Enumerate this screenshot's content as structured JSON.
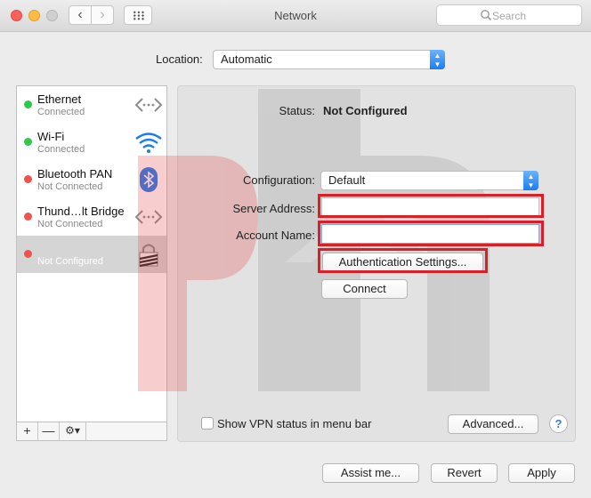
{
  "window": {
    "title": "Network"
  },
  "toolbar": {
    "search_placeholder": "Search"
  },
  "location": {
    "label": "Location:",
    "value": "Automatic"
  },
  "services": [
    {
      "name": "Ethernet",
      "status": "Connected",
      "dot": "green",
      "icon": "ethernet-icon"
    },
    {
      "name": "Wi-Fi",
      "status": "Connected",
      "dot": "green",
      "icon": "wifi-icon"
    },
    {
      "name": "Bluetooth PAN",
      "status": "Not Connected",
      "dot": "red",
      "icon": "bluetooth-icon"
    },
    {
      "name": "Thund…lt Bridge",
      "status": "Not Connected",
      "dot": "red",
      "icon": "thunderbolt-bridge-icon"
    },
    {
      "name": "",
      "status": "Not Configured",
      "dot": "red",
      "icon": "vpn-lock-icon"
    }
  ],
  "sidebar_footer": {
    "add": "+",
    "remove": "—",
    "gear": "⚙▾"
  },
  "detail": {
    "status_label": "Status:",
    "status_value": "Not Configured",
    "configuration_label": "Configuration:",
    "configuration_value": "Default",
    "server_address_label": "Server Address:",
    "server_address_value": "",
    "account_name_label": "Account Name:",
    "account_name_value": "",
    "auth_settings_button": "Authentication Settings...",
    "connect_button": "Connect",
    "show_vpn_status_label": "Show VPN status in menu bar",
    "advanced_button": "Advanced...",
    "help_button": "?"
  },
  "footer": {
    "assist_button": "Assist me...",
    "revert_button": "Revert",
    "apply_button": "Apply"
  },
  "colors": {
    "highlight_box": "#dc1f26",
    "accent": "#1a7cf3",
    "connected": "#2ec94b",
    "not_connected": "#f0524e"
  }
}
